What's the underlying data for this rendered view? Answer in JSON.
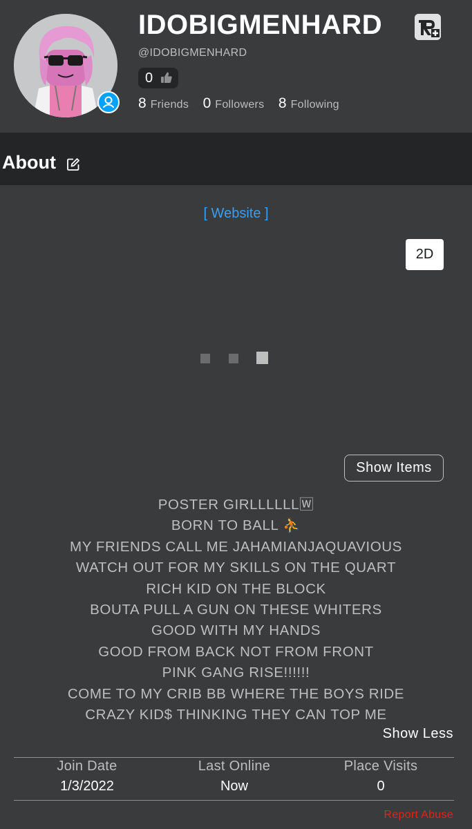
{
  "profile": {
    "display_name": "IDOBIGMENHARD",
    "username": "@IDOBIGMENHARD",
    "reputation": "0",
    "stats": [
      {
        "count": "8",
        "label": "Friends"
      },
      {
        "count": "0",
        "label": "Followers"
      },
      {
        "count": "8",
        "label": "Following"
      }
    ]
  },
  "about": {
    "title": "About",
    "website_link": "[ Website ]",
    "view_toggle_label": "2D",
    "show_items_label": "Show Items",
    "bio_lines": [
      "POSTER GIRLLLLLL🅆",
      "BORN TO BALL ⛹",
      "MY FRIENDS CALL ME JAHAMIANJAQUAVIOUS",
      "WATCH OUT FOR MY SKILLS ON THE QUART",
      "RICH KID ON THE BLOCK",
      "BOUTA PULL A GUN ON THESE WHITERS",
      "GOOD WITH MY HANDS",
      "GOOD FROM BACK NOT FROM FRONT",
      "PINK GANG RISE!!!!!!",
      "COME TO MY CRIB BB WHERE THE BOYS RIDE",
      "CRAZY KID$ THINKING THEY CAN TOP ME"
    ],
    "show_less_label": "Show Less"
  },
  "footer": {
    "stats": [
      {
        "label": "Join Date",
        "value": "1/3/2022"
      },
      {
        "label": "Last Online",
        "value": "Now"
      },
      {
        "label": "Place Visits",
        "value": "0"
      }
    ],
    "report_label": "Report Abuse"
  },
  "colors": {
    "page_bg": "#232527",
    "panel_bg": "#393b3d",
    "link_blue": "#3a9ff2",
    "report_red": "#e2231a",
    "presence_blue": "#00a2ff"
  },
  "icons": {
    "premium": "premium-icon",
    "thumb": "thumbs-up-icon",
    "edit": "edit-icon",
    "presence": "user-presence-icon"
  }
}
